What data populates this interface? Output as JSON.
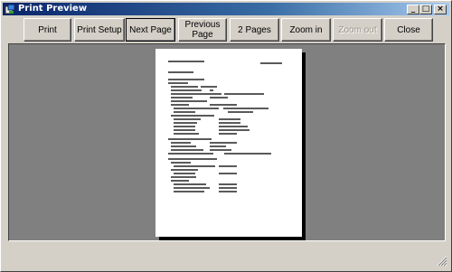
{
  "window": {
    "title": "Print Preview",
    "icon": "print-preview-app-icon",
    "controls": {
      "minimize": "_",
      "maximize": "□",
      "close": "×"
    }
  },
  "toolbar": {
    "print": "Print",
    "print_setup": "Print Setup",
    "next_page": "Next Page",
    "previous_page": "Previous Page",
    "two_pages": "2 Pages",
    "zoom_in": "Zoom in",
    "zoom_out": "Zoom out",
    "close": "Close"
  },
  "colors": {
    "title_gradient_start": "#0a246a",
    "title_gradient_end": "#a6caf0",
    "preview_background": "#808080",
    "face": "#d4d0c8"
  }
}
